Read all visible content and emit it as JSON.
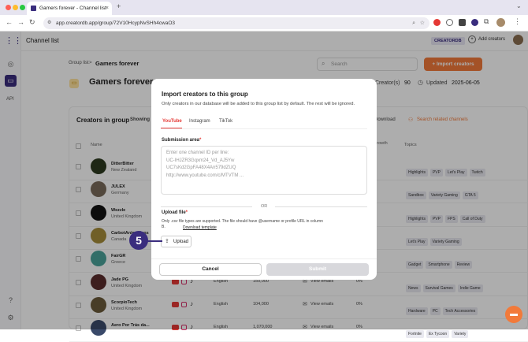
{
  "browser": {
    "tab_title": "Gamers forever - Channel list",
    "new_tab": "+",
    "url": "app.creatordb.app/group/72V10HcypNvSHh4cwaO3"
  },
  "topbar": {
    "title": "Channel list",
    "brand": "CREATORDB",
    "add_creators": "Add creators"
  },
  "sidebar": {
    "api_label": "API"
  },
  "page": {
    "breadcrumb_root": "Group list",
    "breadcrumb_sep": ">",
    "breadcrumb_current": "Gamers forever",
    "group_title": "Gamers forever",
    "search_placeholder": "Search",
    "import_button": "+ Import creators",
    "creators_label": "Creator(s)",
    "creators_count": "90",
    "updated_label": "Updated",
    "updated_date": "2025-06-05",
    "creators_in_group": "Creators in group",
    "showing": "Showing",
    "download": "Download",
    "search_related": "Search related channels",
    "col_name": "Name",
    "col_growth": "Growth",
    "col_topics": "Topics"
  },
  "rows": [
    {
      "name": "DitterBitter",
      "country": "New Zealand",
      "tags": [
        "Highlights",
        "PVP",
        "Let's Play",
        "Twitch"
      ],
      "avatar_color": "#2d3a1f"
    },
    {
      "name": "JULEX",
      "country": "Germany",
      "tags": [
        "Sandbox",
        "Variety Gaming",
        "GTA 5"
      ],
      "avatar_color": "#7a6a5a"
    },
    {
      "name": "Wezzle",
      "country": "United Kingdom",
      "tags": [
        "Highlights",
        "PVP",
        "FPS",
        "Call of Duty"
      ],
      "avatar_color": "#111111"
    },
    {
      "name": "CarbotAnimations",
      "country": "Canada",
      "tags": [
        "Let's Play",
        "Variety Gaming"
      ],
      "avatar_color": "#a58c3a"
    },
    {
      "name": "FairGR",
      "country": "Greece",
      "tags": [
        "Gadget",
        "Smartphone",
        "Review"
      ],
      "avatar_color": "#4aa39a"
    },
    {
      "name": "Jade PG",
      "country": "United Kingdom",
      "tags": [
        "News",
        "Survival Games",
        "Indie Game"
      ],
      "avatar_color": "#5a2d2d"
    },
    {
      "name": "ScorpioTech",
      "country": "United Kingdom",
      "tags": [
        "Hardware",
        "PC",
        "Tech Accessories"
      ],
      "avatar_color": "#6a5a3a"
    },
    {
      "name": "Aero Por Trás da...",
      "country": "",
      "tags": [
        "Fortnite",
        "Ex Tycoon",
        "Variety"
      ],
      "avatar_color": "#3a4a6a"
    }
  ],
  "table_extra": [
    {
      "lang": "English",
      "subs": "150,000",
      "emails": "View emails",
      "pct": "0%"
    },
    {
      "lang": "English",
      "subs": "104,000",
      "emails": "View emails",
      "pct": "0%"
    },
    {
      "lang": "English",
      "subs": "1,070,000",
      "emails": "View emails",
      "pct": "0%"
    }
  ],
  "modal": {
    "title": "Import creators to this group",
    "subtitle": "Only creators in our database will be added to this group list by default. The rest will be ignored.",
    "tabs": [
      "YouTube",
      "Instagram",
      "TikTok"
    ],
    "submission_label": "Submission area",
    "required_mark": "*",
    "placeholder_lines": [
      "Enter one channel ID per line:",
      "UC-IHJZR3Gqxm24_Vd_AJ5Yw",
      "UC7sKd2GpFA48X4An579dZUQ",
      "http://www.youtube.com/c/MTVTM ..."
    ],
    "or": "OR",
    "upload_label": "Upload file",
    "upload_note": "Only .csv file types are supported. The file should have @username or profile URL in column B.",
    "download_template": "Download template",
    "upload_button": "Upload",
    "cancel": "Cancel",
    "submit": "Submit"
  },
  "step_marker": "5",
  "colors": {
    "accent": "#f27a3a",
    "brand": "#3a2d7e",
    "youtube_red": "#e53935"
  }
}
